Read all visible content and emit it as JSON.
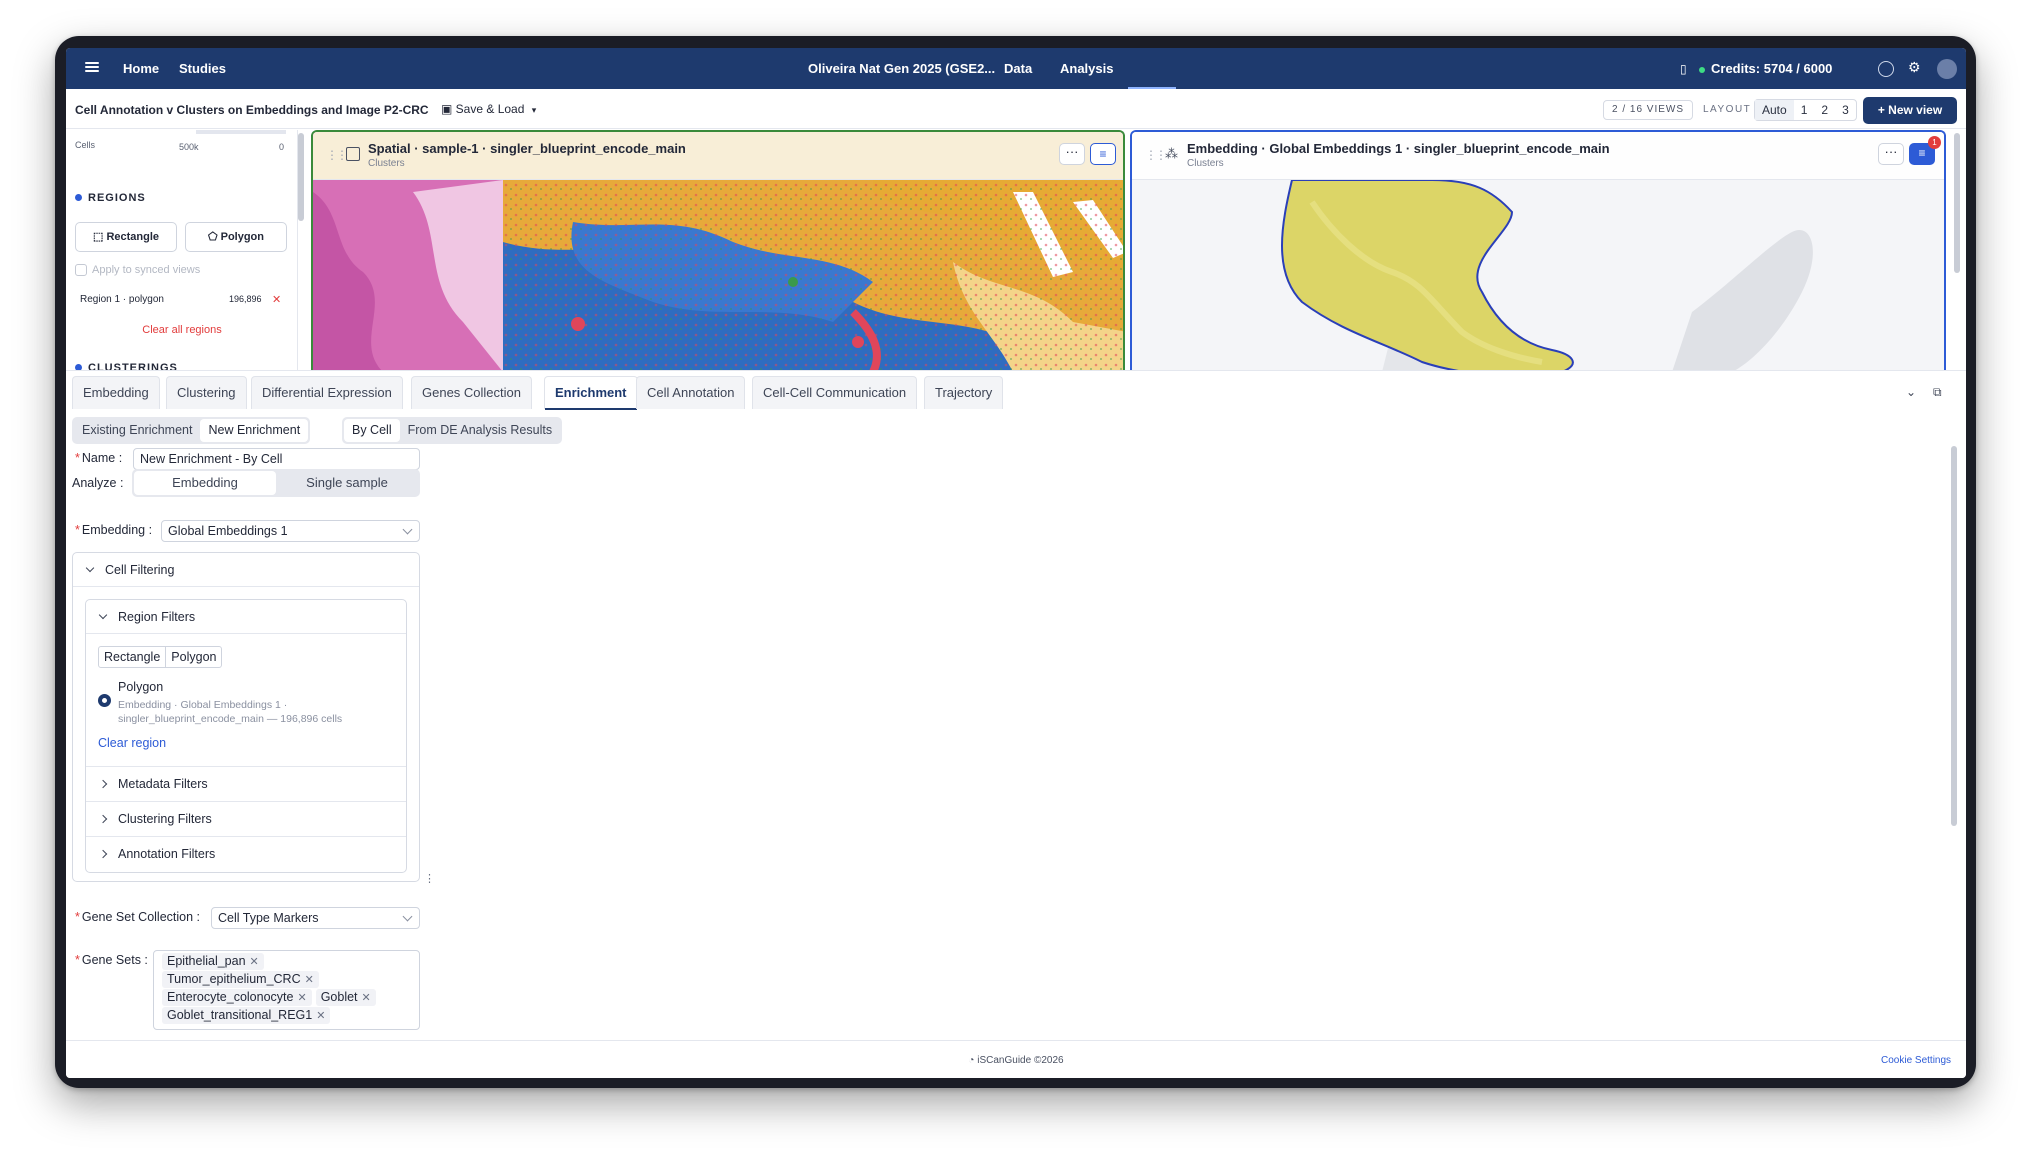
{
  "nav": {
    "home": "Home",
    "studies": "Studies",
    "project": "Oliveira Nat Gen 2025 (GSE2...",
    "data": "Data",
    "analysis": "Analysis",
    "credits": "Credits: 5704 / 6000"
  },
  "subheader": {
    "title": "Cell Annotation v Clusters on Embeddings and Image P2-CRC",
    "save_load": "Save & Load",
    "views_count": "2 / 16 VIEWS",
    "layout_label": "LAYOUT",
    "layout_options": [
      "Auto",
      "1",
      "2",
      "3"
    ],
    "new_view": "New view"
  },
  "left_panel": {
    "cells_label": "Cells",
    "cells_max": "500k",
    "cells_min": "0",
    "regions_title": "REGIONS",
    "rectangle_btn": "Rectangle",
    "polygon_btn": "Polygon",
    "apply_synced": "Apply to synced views",
    "region_name": "Region 1 · polygon",
    "region_count": "196,896",
    "clear_all": "Clear all regions",
    "clusterings_title": "CLUSTERINGS"
  },
  "views": [
    {
      "title": "Spatial · sample-1 · singler_blueprint_encode_main",
      "subtitle": "Clusters"
    },
    {
      "title": "Embedding · Global Embeddings 1 · singler_blueprint_encode_main",
      "subtitle": "Clusters",
      "badge": "1"
    }
  ],
  "tabs": [
    "Embedding",
    "Clustering",
    "Differential Expression",
    "Genes Collection",
    "Enrichment",
    "Cell Annotation",
    "Cell-Cell Communication",
    "Trajectory"
  ],
  "active_tab": "Enrichment",
  "enrichment": {
    "mode_options": [
      "Existing Enrichment",
      "New Enrichment"
    ],
    "mode_selected": "New Enrichment",
    "source_options": [
      "By Cell",
      "From DE Analysis Results"
    ],
    "source_selected": "By Cell",
    "name_label": "Name",
    "name_value": "New Enrichment - By Cell",
    "analyze_label": "Analyze",
    "analyze_options": [
      "Embedding",
      "Single sample"
    ],
    "analyze_selected": "Embedding",
    "embedding_label": "Embedding",
    "embedding_value": "Global Embeddings 1",
    "cell_filtering": "Cell Filtering",
    "region_filters": "Region Filters",
    "shape_options": [
      "Rectangle",
      "Polygon"
    ],
    "polygon_title": "Polygon",
    "polygon_desc": "Embedding · Global Embeddings 1 · singler_blueprint_encode_main — 196,896 cells",
    "clear_region": "Clear region",
    "metadata_filters": "Metadata Filters",
    "clustering_filters": "Clustering Filters",
    "annotation_filters": "Annotation Filters",
    "gene_set_collection_label": "Gene Set Collection",
    "gene_set_collection_value": "Cell Type Markers",
    "gene_sets_label": "Gene Sets",
    "gene_sets": [
      "Epithelial_pan",
      "Tumor_epithelium_CRC",
      "Enterocyte_colonocyte",
      "Goblet",
      "Goblet_transitional_REG1"
    ]
  },
  "footer": {
    "copyright": "iSCanGuide ©2026",
    "cookie": "Cookie Settings"
  },
  "colors": {
    "nav_bg": "#1e3a6e",
    "accent_blue": "#2d5bd6",
    "danger": "#e23c3c",
    "spatial_border": "#3a8a3a"
  }
}
